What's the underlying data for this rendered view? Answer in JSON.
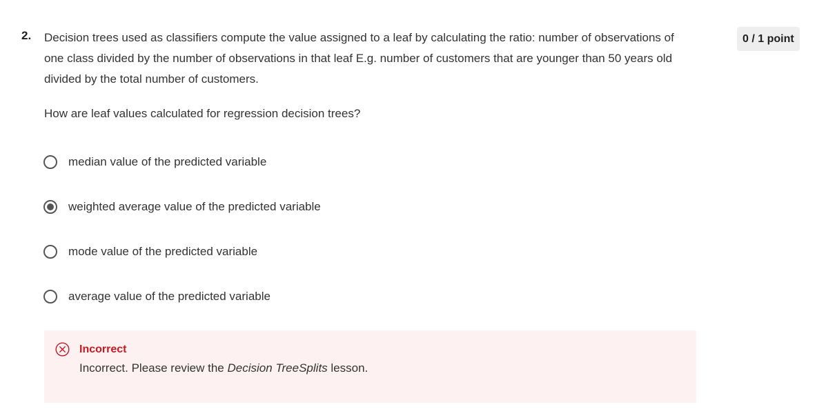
{
  "question": {
    "number": "2.",
    "text": "Decision trees used as classifiers compute the value assigned to a leaf by calculating the ratio: number of observations of one class divided by the number of observations in that leaf E.g. number of customers that are younger than 50 years old divided by the total number of customers.",
    "prompt": "How are leaf values calculated for regression decision trees?",
    "points": "0 / 1 point"
  },
  "options": [
    {
      "label": "median value of the predicted variable",
      "selected": false
    },
    {
      "label": "weighted average value of the predicted variable",
      "selected": true
    },
    {
      "label": "mode value of the predicted variable",
      "selected": false
    },
    {
      "label": "average value of the predicted variable",
      "selected": false
    }
  ],
  "feedback": {
    "icon": "x-circle-icon",
    "title": "Incorrect",
    "text_before": "Incorrect. Please review the ",
    "lesson_name": "Decision TreeSplits",
    "text_after": " lesson.",
    "color": "#c41b23",
    "background": "#fdf1f2"
  }
}
